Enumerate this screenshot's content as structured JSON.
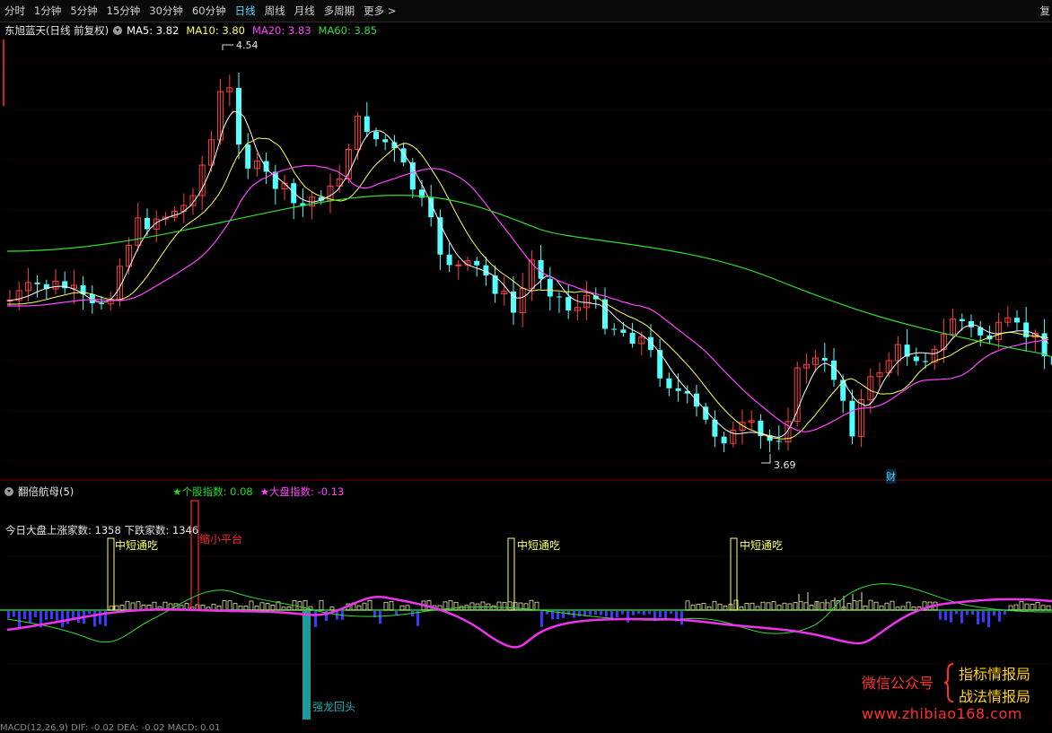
{
  "toolbar": {
    "tabs": [
      {
        "label": "分时",
        "active": false
      },
      {
        "label": "1分钟",
        "active": false
      },
      {
        "label": "5分钟",
        "active": false
      },
      {
        "label": "15分钟",
        "active": false
      },
      {
        "label": "30分钟",
        "active": false
      },
      {
        "label": "60分钟",
        "active": false
      },
      {
        "label": "日线",
        "active": true
      },
      {
        "label": "周线",
        "active": false
      },
      {
        "label": "月线",
        "active": false
      },
      {
        "label": "多周期",
        "active": false
      },
      {
        "label": "更多 >",
        "active": false
      }
    ],
    "right_label": "复"
  },
  "main_chart": {
    "stock_title": "东旭蓝天(日线 前复权)",
    "ma5": "MA5: 3.82",
    "ma10": "MA10: 3.80",
    "ma20": "MA20: 3.83",
    "ma60": "MA60: 3.85",
    "high_label": "4.54",
    "low_label": "3.69",
    "event_badge": "财"
  },
  "sub_chart": {
    "indicator_name": "翻倍航母(5)",
    "stock_index": "★个股指数: 0.08",
    "market_index": "★大盘指数: -0.13",
    "adv_dec": "今日大盘上涨家数: 1358 下跌家数: 1346",
    "signals": {
      "s1": "中短通吃",
      "s2": "缩小平台",
      "s3": "中短通吃",
      "s4": "中短通吃",
      "s5": "强龙回头"
    }
  },
  "watermark": {
    "account": "微信公众号",
    "line1": "指标情报局",
    "line2": "战法情报局",
    "url": "www.zhibiao168.com"
  },
  "bottom": "MACD(12,26,9) DIF: -0.02 DEA: -0.02 MACD: 0.01",
  "colors": {
    "up": "#ff4040",
    "down": "#54ffff",
    "ma5": "#ffffff",
    "ma10": "#ffff66",
    "ma20": "#ff44ff",
    "ma60": "#33dd33",
    "grid": "#5a0000"
  }
}
